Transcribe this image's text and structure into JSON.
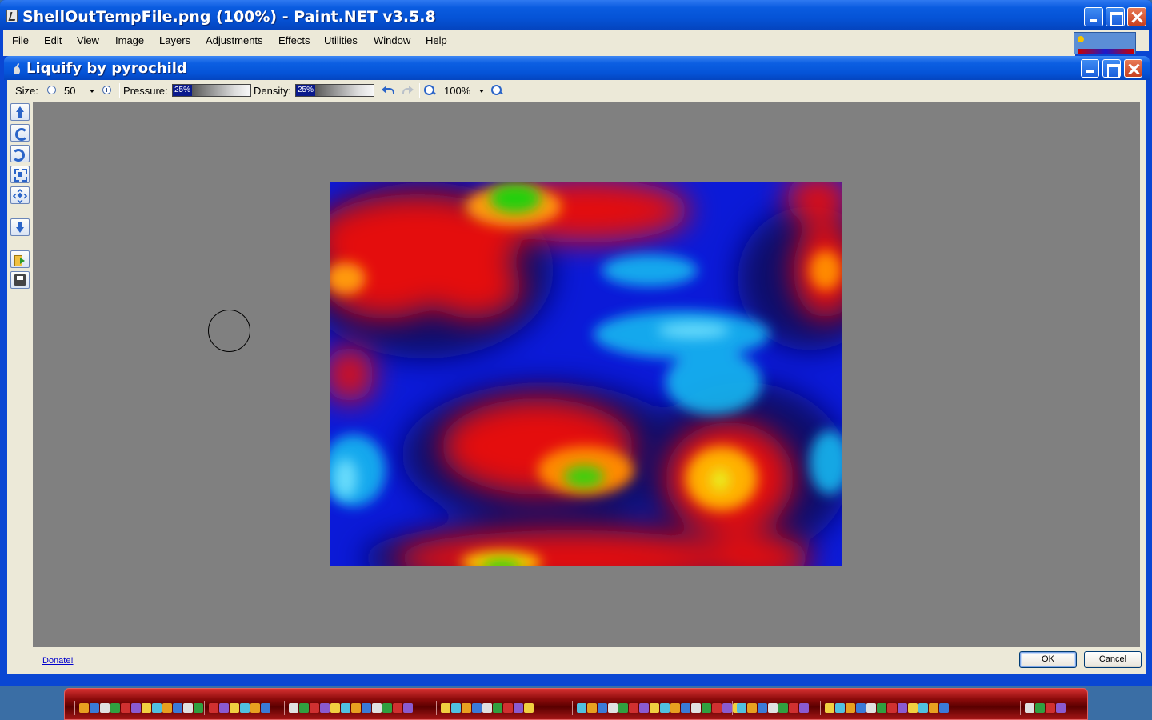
{
  "main_window": {
    "title": "ShellOutTempFile.png (100%) - Paint.NET v3.5.8",
    "menu": [
      "File",
      "Edit",
      "View",
      "Image",
      "Layers",
      "Adjustments",
      "Effects",
      "Utilities",
      "Window",
      "Help"
    ]
  },
  "dialog": {
    "title": "Liquify by pyrochild",
    "toolbar": {
      "size_label": "Size:",
      "size_value": "50",
      "pressure_label": "Pressure:",
      "pressure_value": "25%",
      "pressure_fraction": 0.25,
      "density_label": "Density:",
      "density_value": "25%",
      "density_fraction": 0.25,
      "zoom_value": "100%"
    },
    "side_tools": [
      "move-up-icon",
      "rotate-cw-icon",
      "rotate-ccw-icon",
      "expand-icon",
      "contract-icon",
      "move-down-icon",
      "open-file-icon",
      "save-icon"
    ],
    "donate_label": "Donate!",
    "ok_label": "OK",
    "cancel_label": "Cancel"
  },
  "colors": {
    "titlebar_blue": "#0553d6",
    "dialog_face": "#ece9d8",
    "canvas_gray": "#808080",
    "taskbar_red": "#8a0a0a"
  }
}
